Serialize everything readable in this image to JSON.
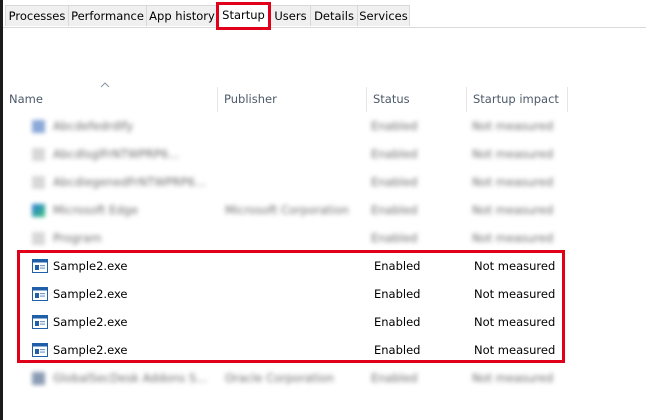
{
  "tabs": [
    {
      "label": "Processes"
    },
    {
      "label": "Performance"
    },
    {
      "label": "App history"
    },
    {
      "label": "Startup",
      "active": true
    },
    {
      "label": "Users"
    },
    {
      "label": "Details"
    },
    {
      "label": "Services"
    }
  ],
  "columns": {
    "name": "Name",
    "publisher": "Publisher",
    "status": "Status",
    "impact": "Startup impact"
  },
  "blurred_rows": [
    {
      "name": "AbcdefedrdIfy",
      "publisher": "",
      "status": "Enabled",
      "impact": "Not measured"
    },
    {
      "name": "AbcdlsglFrNTWPRP6...",
      "publisher": "",
      "status": "Enabled",
      "impact": "Not measured"
    },
    {
      "name": "AbcdiegenedFrNTWPRP6...",
      "publisher": "",
      "status": "Enabled",
      "impact": "Not measured"
    },
    {
      "name": "Microsoft Edge",
      "publisher": "Microsoft Corporation",
      "status": "Enabled",
      "impact": "Not measured"
    },
    {
      "name": "Program",
      "publisher": "",
      "status": "Enabled",
      "impact": "Not measured"
    }
  ],
  "rows": [
    {
      "name": "Sample2.exe",
      "publisher": "",
      "status": "Enabled",
      "impact": "Not measured"
    },
    {
      "name": "Sample2.exe",
      "publisher": "",
      "status": "Enabled",
      "impact": "Not measured"
    },
    {
      "name": "Sample2.exe",
      "publisher": "",
      "status": "Enabled",
      "impact": "Not measured"
    },
    {
      "name": "Sample2.exe",
      "publisher": "",
      "status": "Enabled",
      "impact": "Not measured"
    }
  ],
  "blurred_bottom_row": {
    "name": "GlobalSecDesk Addons S...",
    "publisher": "Oracle Corporation",
    "status": "Enabled",
    "impact": "Not measured"
  },
  "colors": {
    "highlight": "#e0001a",
    "header_text": "#4d5a6a"
  }
}
